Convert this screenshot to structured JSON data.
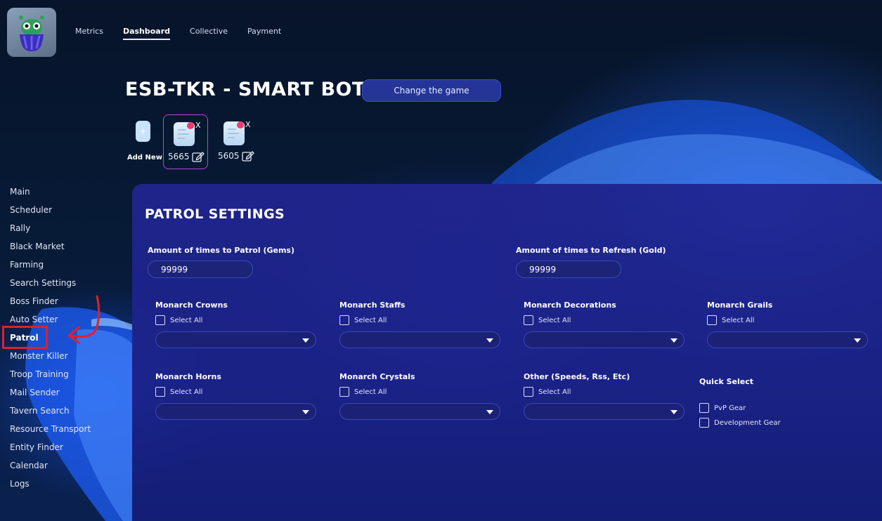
{
  "nav": {
    "items": [
      {
        "label": "Metrics",
        "active": false
      },
      {
        "label": "Dashboard",
        "active": true
      },
      {
        "label": "Collective",
        "active": false
      },
      {
        "label": "Payment",
        "active": false
      }
    ]
  },
  "header": {
    "title": "ESB-TKR - SMART BOT",
    "change_game_label": "Change the game"
  },
  "accounts": {
    "add_new_label": "Add New",
    "add_icon": "+",
    "remove_label": "X",
    "items": [
      {
        "id": "5665",
        "selected": true
      },
      {
        "id": "5605",
        "selected": false
      }
    ]
  },
  "sidebar": {
    "items": [
      {
        "label": "Main"
      },
      {
        "label": "Scheduler"
      },
      {
        "label": "Rally"
      },
      {
        "label": "Black Market"
      },
      {
        "label": "Farming"
      },
      {
        "label": "Search Settings"
      },
      {
        "label": "Boss Finder"
      },
      {
        "label": "Auto Setter"
      },
      {
        "label": "Patrol",
        "active": true
      },
      {
        "label": "Monster Killer"
      },
      {
        "label": "Troop Training"
      },
      {
        "label": "Mail Sender"
      },
      {
        "label": "Tavern Search"
      },
      {
        "label": "Resource Transport"
      },
      {
        "label": "Entity Finder"
      },
      {
        "label": "Calendar"
      },
      {
        "label": "Logs"
      }
    ]
  },
  "patrol": {
    "title": "PATROL SETTINGS",
    "gems_label": "Amount of times to Patrol (Gems)",
    "gems_value": "99999",
    "gold_label": "Amount of times to Refresh (Gold)",
    "gold_value": "99999",
    "select_all_label": "Select All",
    "groups": [
      {
        "label": "Monarch Crowns"
      },
      {
        "label": "Monarch Staffs"
      },
      {
        "label": "Monarch Decorations"
      },
      {
        "label": "Monarch Grails"
      },
      {
        "label": "Monarch Horns"
      },
      {
        "label": "Monarch Crystals"
      },
      {
        "label": "Other (Speeds, Rss, Etc)"
      }
    ],
    "quick_select": {
      "label": "Quick Select",
      "options": [
        {
          "label": "PvP Gear"
        },
        {
          "label": "Development Gear"
        }
      ]
    }
  },
  "colors": {
    "accent": "#243597",
    "highlight": "#e0202a",
    "selected_border": "#b04ad8"
  }
}
